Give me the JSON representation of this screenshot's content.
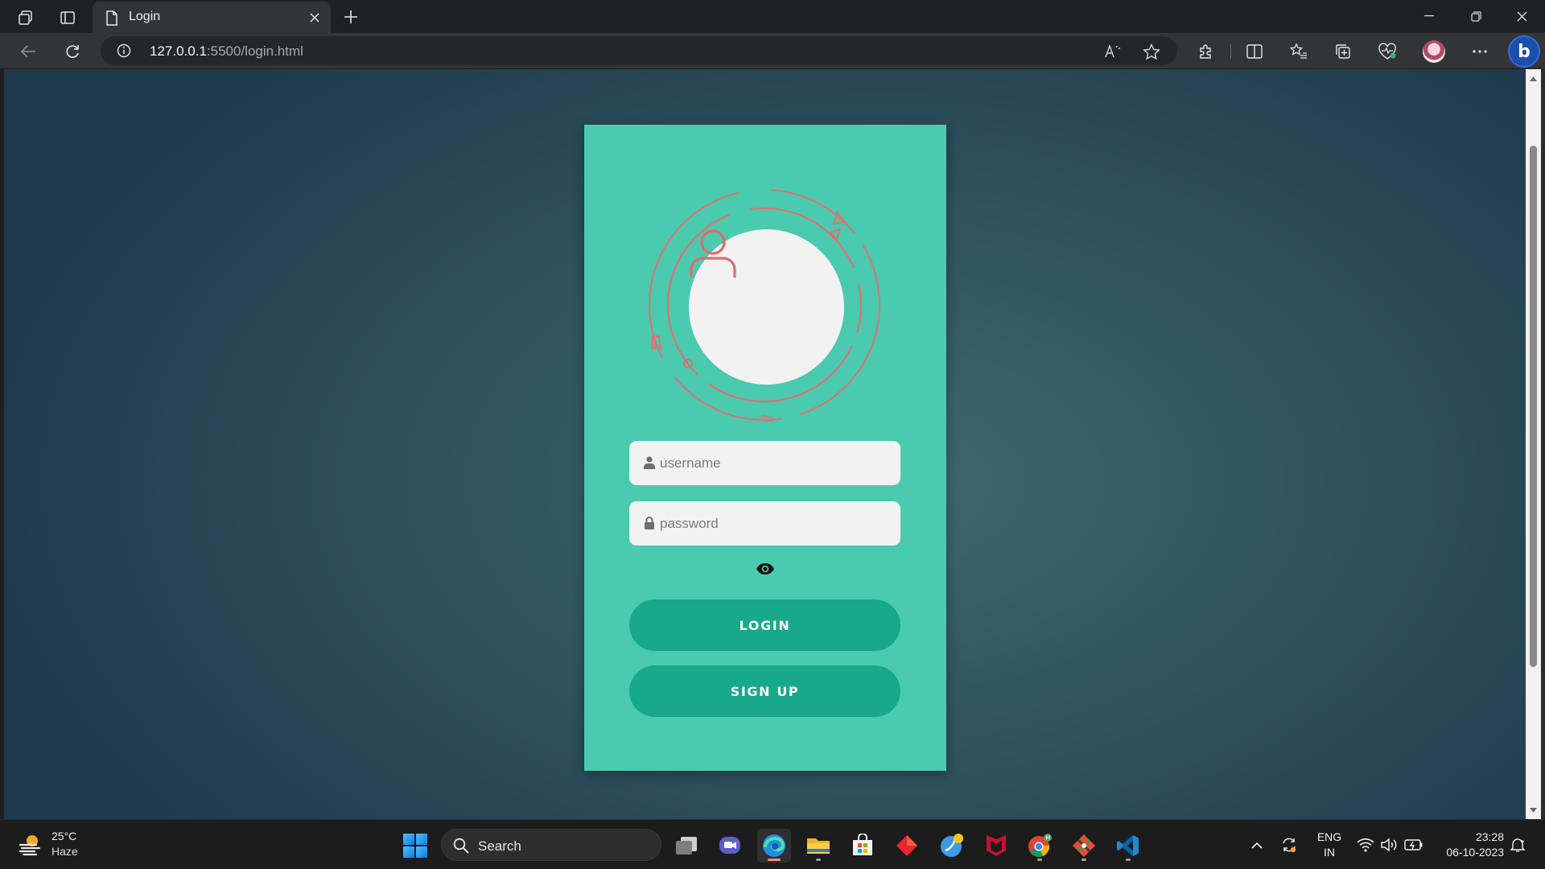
{
  "browser": {
    "tab_title": "Login",
    "url_host": "127.0.0.1",
    "url_rest": ":5500/login.html"
  },
  "login_form": {
    "username_placeholder": "username",
    "password_placeholder": "password",
    "login_label": "LOGIN",
    "signup_label": "SIGN UP"
  },
  "colors": {
    "card_background": "#4acaaf",
    "button_background": "#18a88a",
    "accent_ring": "#e07070",
    "page_background": "#31545f"
  },
  "taskbar": {
    "weather_temp": "25°C",
    "weather_desc": "Haze",
    "search_label": "Search",
    "lang_line1": "ENG",
    "lang_line2": "IN",
    "time": "23:28",
    "date": "06-10-2023",
    "apps": [
      "task-view",
      "teams-chat",
      "edge",
      "file-explorer",
      "microsoft-store",
      "app-red-diamond",
      "app-blue-swirl",
      "mcafee",
      "chrome",
      "git-gui",
      "vscode"
    ]
  }
}
